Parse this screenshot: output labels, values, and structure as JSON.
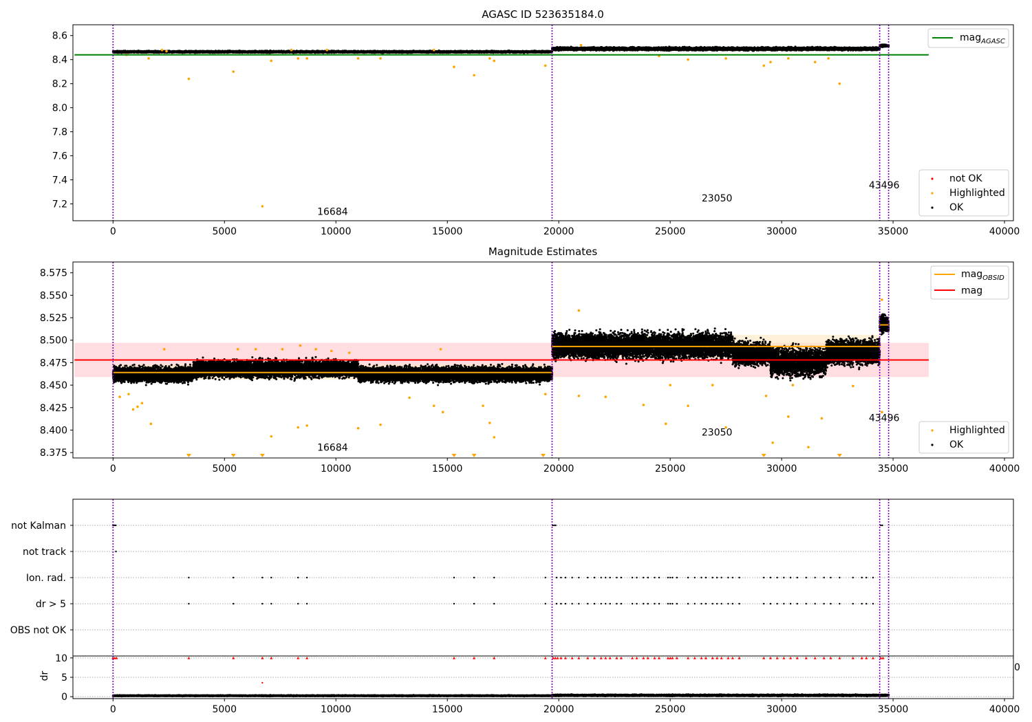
{
  "figure": {
    "background": "#ffffff"
  },
  "chart_data": [
    {
      "type": "scatter",
      "title": "AGASC ID 523635184.0",
      "xlabel": "",
      "ylabel": "",
      "xlim": [
        -1800,
        40400
      ],
      "ylim": [
        7.06,
        8.69
      ],
      "xticks": [
        0,
        5000,
        10000,
        15000,
        20000,
        25000,
        30000,
        35000,
        40000
      ],
      "yticks": [
        7.2,
        7.4,
        7.6,
        7.8,
        8.0,
        8.2,
        8.4,
        8.6
      ],
      "obsid_boundaries": [
        0,
        19700,
        34400,
        34800
      ],
      "obsid_labels": [
        {
          "text": "16684",
          "x": 9850,
          "y": 7.11
        },
        {
          "text": "23050",
          "x": 27100,
          "y": 7.22
        },
        {
          "text": "43496",
          "x": 34600,
          "y": 7.33
        }
      ],
      "reference_lines": [
        {
          "name": "mag_AGASC",
          "y": 8.44,
          "x_range": [
            0,
            36600
          ],
          "color": "#008000"
        }
      ],
      "series": [
        {
          "name": "OK",
          "color": "#000000",
          "bands": [
            {
              "x_range": [
                0,
                19700
              ],
              "center": 8.465,
              "halfwidth": 0.012
            },
            {
              "x_range": [
                19700,
                34400
              ],
              "center": 8.49,
              "halfwidth": 0.02
            },
            {
              "x_range": [
                34400,
                34800
              ],
              "center": 8.515,
              "halfwidth": 0.015
            }
          ]
        },
        {
          "name": "Highlighted",
          "color": "#ffa500",
          "points": [
            [
              3400,
              8.24
            ],
            [
              5400,
              8.3
            ],
            [
              6700,
              7.18
            ],
            [
              7100,
              8.39
            ],
            [
              8300,
              8.41
            ],
            [
              8700,
              8.41
            ],
            [
              11000,
              8.41
            ],
            [
              12000,
              8.41
            ],
            [
              15300,
              8.34
            ],
            [
              16200,
              8.27
            ],
            [
              16900,
              8.41
            ],
            [
              17100,
              8.39
            ],
            [
              19400,
              8.35
            ],
            [
              24500,
              8.43
            ],
            [
              25800,
              8.4
            ],
            [
              27500,
              8.41
            ],
            [
              29200,
              8.35
            ],
            [
              29500,
              8.38
            ],
            [
              31500,
              8.38
            ],
            [
              32100,
              8.41
            ],
            [
              32600,
              8.2
            ],
            [
              600,
              8.44
            ],
            [
              1600,
              8.41
            ],
            [
              2200,
              8.48
            ],
            [
              2400,
              8.47
            ],
            [
              8000,
              8.48
            ],
            [
              9600,
              8.48
            ],
            [
              14400,
              8.48
            ],
            [
              21000,
              8.52
            ],
            [
              30300,
              8.41
            ]
          ]
        },
        {
          "name": "not OK",
          "color": "#ff0000",
          "points": []
        }
      ],
      "legends": [
        {
          "placement": "top-right",
          "entries": [
            {
              "label": "mag",
              "subscript": "AGASC",
              "kind": "line",
              "color": "#008000"
            }
          ]
        },
        {
          "placement": "lower-right",
          "entries": [
            {
              "label": "not OK",
              "kind": "dot",
              "color": "#ff0000"
            },
            {
              "label": "Highlighted",
              "kind": "dot",
              "color": "#ffa500"
            },
            {
              "label": "OK",
              "kind": "dot",
              "color": "#000000"
            }
          ]
        }
      ]
    },
    {
      "type": "scatter",
      "title": "Magnitude Estimates",
      "xlabel": "",
      "ylabel": "",
      "xlim": [
        -1800,
        40400
      ],
      "ylim": [
        8.369,
        8.587
      ],
      "xticks": [
        0,
        5000,
        10000,
        15000,
        20000,
        25000,
        30000,
        35000,
        40000
      ],
      "yticks": [
        8.375,
        8.4,
        8.425,
        8.45,
        8.475,
        8.5,
        8.525,
        8.55,
        8.575
      ],
      "obsid_boundaries": [
        0,
        19700,
        34400,
        34800
      ],
      "obsid_labels": [
        {
          "text": "16684",
          "x": 9850,
          "y": 8.377
        },
        {
          "text": "23050",
          "x": 27100,
          "y": 8.394
        },
        {
          "text": "43496",
          "x": 34600,
          "y": 8.41
        }
      ],
      "reference_lines": [
        {
          "name": "mag",
          "y": 8.478,
          "x_range": [
            0,
            36600
          ],
          "color": "#ff0000",
          "band": [
            8.459,
            8.497
          ]
        }
      ],
      "obsid_means": [
        {
          "x_range": [
            0,
            19700
          ],
          "y": 8.464,
          "band": [
            8.456,
            8.473
          ]
        },
        {
          "x_range": [
            19700,
            34400
          ],
          "y": 8.493,
          "band": [
            8.48,
            8.506
          ]
        },
        {
          "x_range": [
            34400,
            34800
          ],
          "y": 8.517,
          "band": [
            8.51,
            8.525
          ]
        }
      ],
      "series": [
        {
          "name": "OK",
          "color": "#000000",
          "bands": [
            {
              "x_range": [
                0,
                3600
              ],
              "center": 8.462,
              "halfwidth": 0.013
            },
            {
              "x_range": [
                3600,
                11000
              ],
              "center": 8.468,
              "halfwidth": 0.015
            },
            {
              "x_range": [
                11000,
                19700
              ],
              "center": 8.462,
              "halfwidth": 0.013
            },
            {
              "x_range": [
                19700,
                27800
              ],
              "center": 8.494,
              "halfwidth": 0.022
            },
            {
              "x_range": [
                27800,
                29500
              ],
              "center": 8.485,
              "halfwidth": 0.02
            },
            {
              "x_range": [
                29500,
                32000
              ],
              "center": 8.476,
              "halfwidth": 0.025
            },
            {
              "x_range": [
                32000,
                34400
              ],
              "center": 8.487,
              "halfwidth": 0.022
            },
            {
              "x_range": [
                34400,
                34800
              ],
              "center": 8.518,
              "halfwidth": 0.015
            }
          ]
        },
        {
          "name": "Highlighted",
          "color": "#ffa500",
          "points": [
            [
              300,
              8.437
            ],
            [
              700,
              8.44
            ],
            [
              900,
              8.423
            ],
            [
              1100,
              8.426
            ],
            [
              1300,
              8.43
            ],
            [
              1700,
              8.407
            ],
            [
              2300,
              8.49
            ],
            [
              7100,
              8.393
            ],
            [
              8300,
              8.403
            ],
            [
              8700,
              8.405
            ],
            [
              11000,
              8.402
            ],
            [
              12000,
              8.406
            ],
            [
              13300,
              8.436
            ],
            [
              14400,
              8.427
            ],
            [
              14800,
              8.42
            ],
            [
              16600,
              8.427
            ],
            [
              16900,
              8.408
            ],
            [
              17100,
              8.392
            ],
            [
              19400,
              8.44
            ],
            [
              20900,
              8.533
            ],
            [
              20900,
              8.438
            ],
            [
              22100,
              8.437
            ],
            [
              23800,
              8.428
            ],
            [
              24800,
              8.407
            ],
            [
              25000,
              8.45
            ],
            [
              25800,
              8.427
            ],
            [
              26900,
              8.45
            ],
            [
              27500,
              8.403
            ],
            [
              29300,
              8.438
            ],
            [
              29600,
              8.386
            ],
            [
              30300,
              8.415
            ],
            [
              30500,
              8.45
            ],
            [
              31200,
              8.381
            ],
            [
              31800,
              8.413
            ],
            [
              33200,
              8.449
            ],
            [
              34500,
              8.545
            ],
            [
              34500,
              8.42
            ],
            [
              5600,
              8.49
            ],
            [
              6400,
              8.49
            ],
            [
              7600,
              8.49
            ],
            [
              8400,
              8.494
            ],
            [
              9100,
              8.49
            ],
            [
              9800,
              8.488
            ],
            [
              10600,
              8.486
            ],
            [
              14700,
              8.49
            ]
          ],
          "clipped": [
            3400,
            5400,
            6700,
            15300,
            16200,
            19300,
            29200,
            32600
          ]
        }
      ],
      "legends": [
        {
          "placement": "top-right",
          "entries": [
            {
              "label": "mag",
              "subscript": "OBSID",
              "kind": "line",
              "color": "#ffa500"
            },
            {
              "label": "mag",
              "subscript": "",
              "kind": "line",
              "color": "#ff0000"
            }
          ]
        },
        {
          "placement": "lower-right",
          "entries": [
            {
              "label": "Highlighted",
              "kind": "dot",
              "color": "#ffa500"
            },
            {
              "label": "OK",
              "kind": "dot",
              "color": "#000000"
            }
          ]
        }
      ]
    },
    {
      "type": "scatter",
      "title": "",
      "xlabel": "",
      "ylabel": "",
      "xlim": [
        -1800,
        40400
      ],
      "categories": [
        "not Kalman",
        "not track",
        "Ion. rad.",
        "dr > 5",
        "OBS not OK"
      ],
      "obsid_boundaries": [
        0,
        19700,
        34400,
        34800
      ],
      "flag_points": {
        "not Kalman": [
          0,
          60,
          120,
          19720,
          19790,
          19860,
          34450,
          34520
        ],
        "not track": [
          130
        ],
        "Ion. rad.": [
          3400,
          5400,
          6700,
          7100,
          8300,
          8700,
          15300,
          16200,
          17100,
          19400,
          19900,
          20100,
          20300,
          20600,
          20900,
          21300,
          21600,
          21900,
          22100,
          22300,
          22600,
          22800,
          23300,
          23500,
          23800,
          24000,
          24300,
          24500,
          24900,
          25000,
          25100,
          25300,
          25800,
          26100,
          26400,
          26600,
          26900,
          27100,
          27300,
          27600,
          27800,
          28100,
          29200,
          29500,
          29800,
          30100,
          30400,
          30700,
          31100,
          31500,
          31900,
          32200,
          32600,
          33200,
          33600,
          33800,
          34100
        ],
        "dr > 5": [
          3400,
          5400,
          6700,
          7100,
          8300,
          8700,
          15300,
          16200,
          17100,
          19400,
          19900,
          20100,
          20300,
          20600,
          20900,
          21300,
          21600,
          21900,
          22100,
          22300,
          22600,
          22800,
          23300,
          23500,
          23800,
          24000,
          24300,
          24500,
          24900,
          25000,
          25100,
          25300,
          25800,
          26100,
          26400,
          26600,
          26900,
          27100,
          27300,
          27600,
          27800,
          28100,
          29200,
          29500,
          29800,
          30100,
          30400,
          30700,
          31100,
          31500,
          31900,
          32200,
          32600,
          33200,
          33600,
          33800,
          34100
        ],
        "OBS not OK": []
      }
    },
    {
      "type": "scatter",
      "title": "",
      "xlabel": "",
      "ylabel": "dr",
      "xlim": [
        -1800,
        40400
      ],
      "ylim": [
        -0.5,
        10.5
      ],
      "xticks": [
        0,
        5000,
        10000,
        15000,
        20000,
        25000,
        30000,
        35000,
        40000
      ],
      "yticks": [
        0,
        5,
        10
      ],
      "obsid_boundaries": [
        0,
        19700,
        34400,
        34800
      ],
      "series": [
        {
          "name": "dr",
          "color": "#000000",
          "bands": [
            {
              "x_range": [
                0,
                19700
              ],
              "center": 0.25,
              "halfwidth": 0.2
            },
            {
              "x_range": [
                19700,
                34800
              ],
              "center": 0.35,
              "halfwidth": 0.3
            }
          ]
        },
        {
          "name": "dr > 10",
          "color": "#ff0000",
          "marker": "triangle-up",
          "y": 10,
          "x": [
            0,
            80,
            160,
            3400,
            5400,
            6700,
            7100,
            8300,
            8700,
            15300,
            16200,
            17100,
            19400,
            19750,
            19850,
            19950,
            20100,
            20300,
            20600,
            20900,
            21300,
            21600,
            21900,
            22100,
            22300,
            22600,
            22800,
            23300,
            23500,
            23800,
            24000,
            24300,
            24500,
            24900,
            25000,
            25100,
            25300,
            25800,
            26100,
            26400,
            26600,
            26900,
            27100,
            27300,
            27600,
            27800,
            28100,
            29200,
            29500,
            29800,
            30100,
            30400,
            30700,
            31100,
            31500,
            31900,
            32200,
            32600,
            33200,
            33600,
            33800,
            34100,
            34450,
            34550
          ]
        },
        {
          "name": "dr outlier",
          "color": "#ff0000",
          "points": [
            [
              6700,
              3.6
            ]
          ]
        }
      ],
      "corner_text": "0"
    }
  ]
}
